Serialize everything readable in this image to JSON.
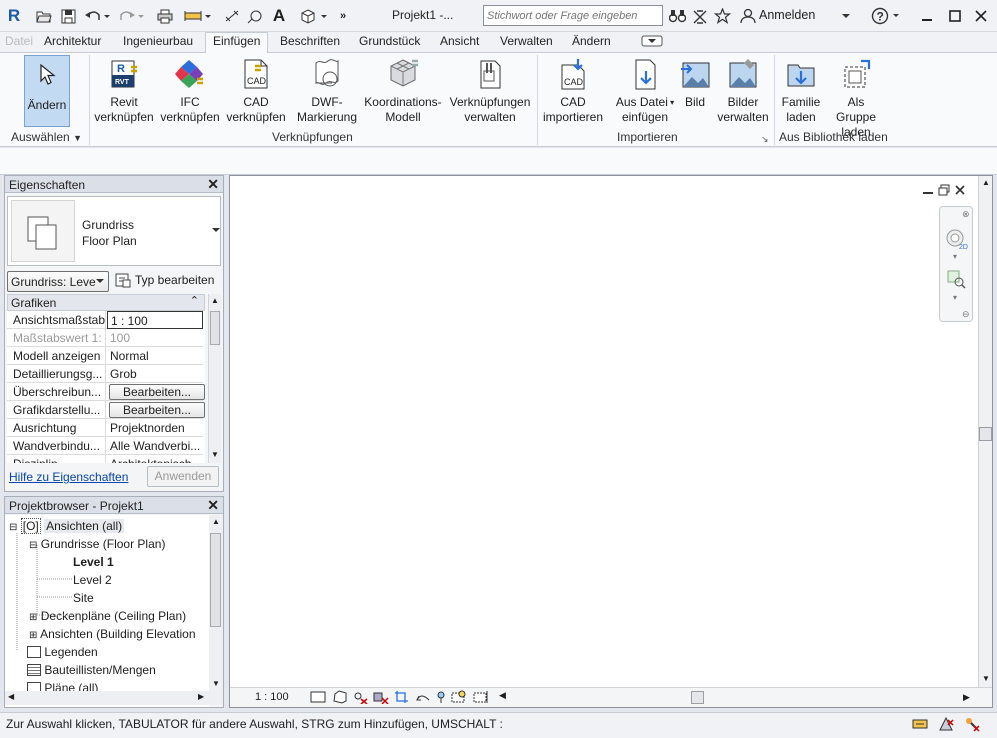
{
  "app": {
    "logo": "R",
    "document_title": "Projekt1 -...",
    "search_placeholder": "Stichwort oder Frage eingeben",
    "sign_in": "Anmelden",
    "help": "?"
  },
  "menu": {
    "tabs": [
      "Datei",
      "Architektur",
      "Ingenieurbau",
      "Einfügen",
      "Beschriften",
      "Grundstück",
      "Ansicht",
      "Verwalten",
      "Ändern"
    ],
    "active": "Einfügen"
  },
  "ribbon": {
    "modify": {
      "label": "Ändern",
      "panel": "Auswählen"
    },
    "link": {
      "buttons": [
        {
          "l1": "Revit",
          "l2": "verknüpfen"
        },
        {
          "l1": "IFC",
          "l2": "verknüpfen"
        },
        {
          "l1": "CAD",
          "l2": "verknüpfen"
        },
        {
          "l1": "DWF-",
          "l2": "Markierung"
        },
        {
          "l1": "Koordinations-",
          "l2": "Modell"
        },
        {
          "l1": "Verknüpfungen",
          "l2": "verwalten"
        }
      ],
      "panel": "Verknüpfungen"
    },
    "import": {
      "buttons": [
        {
          "l1": "CAD",
          "l2": "importieren"
        },
        {
          "l1": "Aus Datei",
          "l2": "einfügen"
        },
        {
          "l1": "Bild",
          "l2": ""
        },
        {
          "l1": "Bilder",
          "l2": "verwalten"
        }
      ],
      "panel": "Importieren"
    },
    "library": {
      "buttons": [
        {
          "l1": "Familie",
          "l2": "laden"
        },
        {
          "l1": "Als Gruppe",
          "l2": "laden"
        }
      ],
      "panel": "Aus Bibliothek laden"
    }
  },
  "properties": {
    "title": "Eigenschaften",
    "type_name_1": "Grundriss",
    "type_name_2": "Floor Plan",
    "filter": "Grundriss: Leve",
    "edit_type": "Typ bearbeiten",
    "group": "Grafiken",
    "rows": [
      {
        "key": "Ansichtsmaßstab",
        "value": "1 : 100"
      },
      {
        "key": "Maßstabswert 1:",
        "value": "100"
      },
      {
        "key": "Modell anzeigen",
        "value": "Normal"
      },
      {
        "key": "Detaillierungsg...",
        "value": "Grob"
      },
      {
        "key": "Überschreibun...",
        "value": "Bearbeiten..."
      },
      {
        "key": "Grafikdarstellu...",
        "value": "Bearbeiten..."
      },
      {
        "key": "Ausrichtung",
        "value": "Projektnorden"
      },
      {
        "key": "Wandverbindu...",
        "value": "Alle Wandverbi..."
      },
      {
        "key": "Disziplin",
        "value": "Architektonisch"
      }
    ],
    "help_link": "Hilfe zu Eigenschaften",
    "apply": "Anwenden"
  },
  "browser": {
    "title": "Projektbrowser - Projekt1",
    "items": [
      "Ansichten (all)",
      "Grundrisse (Floor Plan)",
      "Level 1",
      "Level 2",
      "Site",
      "Deckenpläne (Ceiling Plan)",
      "Ansichten (Building Elevation",
      "Legenden",
      "Bauteillisten/Mengen",
      "Pläne (all)"
    ]
  },
  "view": {
    "scale": "1 : 100"
  },
  "status": {
    "text": "Zur Auswahl klicken, TABULATOR für andere Auswahl, STRG zum Hinzufügen, UMSCHALT :"
  },
  "colors": {
    "accent": "#1c5aa5",
    "selected_tool": "#c3daf3",
    "link": "#0645ad"
  }
}
